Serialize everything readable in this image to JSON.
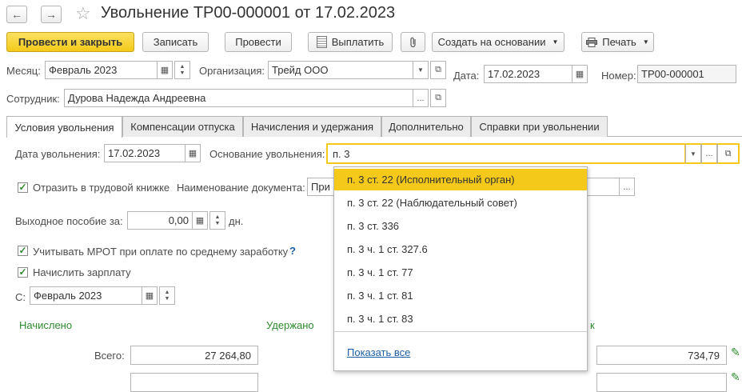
{
  "window": {
    "title": "Увольнение ТР00-000001 от 17.02.2023",
    "back_icon": "←",
    "forward_icon": "→",
    "star_icon": "☆"
  },
  "toolbar": {
    "post_close": "Провести и закрыть",
    "save": "Записать",
    "post": "Провести",
    "pay": "Выплатить",
    "create_based": "Создать на основании",
    "print": "Печать"
  },
  "header": {
    "month_label": "Месяц:",
    "month_value": "Февраль 2023",
    "org_label": "Организация:",
    "org_value": "Трейд ООО",
    "date_label": "Дата:",
    "date_value": "17.02.2023",
    "number_label": "Номер:",
    "number_value": "ТР00-000001",
    "employee_label": "Сотрудник:",
    "employee_value": "Дурова Надежда Андреевна"
  },
  "tabs": [
    "Условия увольнения",
    "Компенсации отпуска",
    "Начисления и удержания",
    "Дополнительно",
    "Справки при увольнении"
  ],
  "form": {
    "dismissal_date_label": "Дата увольнения:",
    "dismissal_date_value": "17.02.2023",
    "basis_label": "Основание увольнения:",
    "basis_value": "п. 3",
    "workbook_label": "Отразить в трудовой книжке",
    "doc_name_label": "Наименование документа:",
    "doc_name_value": "При",
    "severance_label": "Выходное пособие за:",
    "severance_value": "0,00",
    "severance_unit": "дн.",
    "mrot_label": "Учитывать МРОТ при оплате по среднему заработку",
    "help": "?",
    "accrue_label": "Начислить зарплату",
    "from_label": "С:",
    "from_value": "Февраль 2023",
    "accrued_header": "Начислено",
    "withheld_header": "Удержано",
    "third_header_partial": "к",
    "total_label": "Всего:",
    "total_accrued": "27 264,80",
    "total_third": "734,79"
  },
  "dropdown": {
    "items": [
      "п. 3 ст. 22 (Исполнительный орган)",
      "п. 3 ст. 22 (Наблюдательный совет)",
      "п. 3 ст. 336",
      "п. 3 ч. 1 ст. 327.6",
      "п. 3 ч. 1 ст. 77",
      "п. 3 ч. 1 ст. 81",
      "п. 3 ч. 1 ст. 83"
    ],
    "show_all": "Показать все"
  },
  "colors": {
    "accent": "#f4c91a",
    "green": "#2e8b2e",
    "link": "#1a5ea8"
  }
}
